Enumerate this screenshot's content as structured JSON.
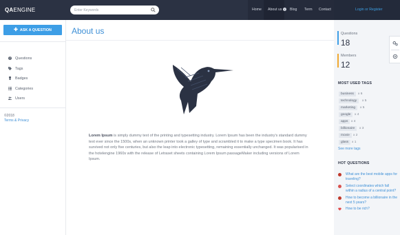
{
  "header": {
    "logo_bold": "QA",
    "logo_light": "ENGINE",
    "search_placeholder": "Enter Keywords",
    "nav": [
      "Home",
      "About us",
      "Blog",
      "Term",
      "Contact"
    ],
    "login": "Login or Register"
  },
  "sidebar": {
    "ask_button": "ASK A QUESTION",
    "items": [
      {
        "label": "Questions",
        "icon": "question-icon"
      },
      {
        "label": "Tags",
        "icon": "tag-icon"
      },
      {
        "label": "Badges",
        "icon": "trophy-icon"
      },
      {
        "label": "Categories",
        "icon": "list-icon"
      },
      {
        "label": "Users",
        "icon": "users-icon"
      }
    ],
    "copyright": "©2018",
    "terms": "Terms & Privacy"
  },
  "main": {
    "title": "About us",
    "article_lead": "Lorem Ipsum",
    "article_body": " is simply dummy text of the printing and typesetting industry. Lorem Ipsum has been the industry's standard dummy text ever since the 1500s, when an unknown printer took a galley of type and scrambled it to make a type specimen book. It has survived not only five centuries, but also the leap into electronic typesetting, remaining essentially unchanged. It was popularised in the hotelengine 1960s with the release of Letraset sheets containing Lorem Ipsum passageMaker including versions of Lorem Ipsum."
  },
  "stats": {
    "questions_label": "Questions",
    "questions_value": "18",
    "members_label": "Members",
    "members_value": "12",
    "colors": {
      "questions": "#3d9ee6",
      "members": "#f0a830"
    }
  },
  "tags_section": {
    "heading": "MOST USED TAGS",
    "tags": [
      {
        "name": "business",
        "count": "x 6"
      },
      {
        "name": "technology",
        "count": "x 5"
      },
      {
        "name": "marketing",
        "count": "x 5"
      },
      {
        "name": "google",
        "count": "x 4"
      },
      {
        "name": "apps",
        "count": "x 4"
      },
      {
        "name": "billionaire",
        "count": "x 3"
      },
      {
        "name": "movie",
        "count": "x 2"
      },
      {
        "name": "glass",
        "count": "x 1"
      }
    ],
    "more": "See more tags"
  },
  "hot_questions": {
    "heading": "HOT QUESTIONS",
    "items": [
      "What are the best mobile apps for traveling?",
      "Select coordinates which fall within a radius of a central point?",
      "How to become a billionaire in the next 5 years?",
      "How to be rich?"
    ]
  }
}
